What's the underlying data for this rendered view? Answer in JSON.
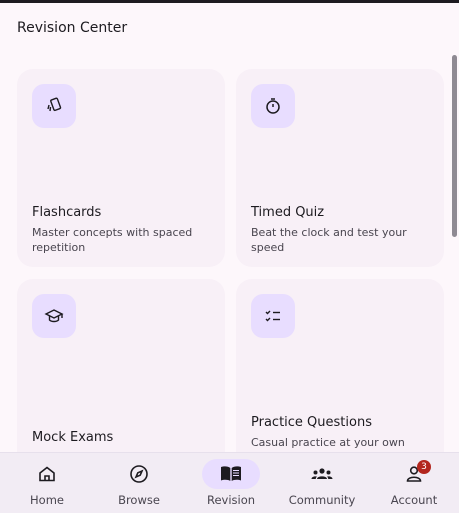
{
  "header": {
    "title": "Revision Center"
  },
  "cards": [
    {
      "title": "Flashcards",
      "desc": "Master concepts with spaced repetition",
      "icon": "flashcards-icon"
    },
    {
      "title": "Timed Quiz",
      "desc": "Beat the clock and test your speed",
      "icon": "timer-icon"
    },
    {
      "title": "Mock Exams",
      "desc": "",
      "icon": "graduation-cap-icon"
    },
    {
      "title": "Practice Questions",
      "desc": "Casual practice at your own",
      "icon": "checklist-icon"
    }
  ],
  "nav": {
    "items": [
      {
        "label": "Home",
        "icon": "home-icon"
      },
      {
        "label": "Browse",
        "icon": "compass-icon"
      },
      {
        "label": "Revision",
        "icon": "book-icon",
        "active": true
      },
      {
        "label": "Community",
        "icon": "people-icon"
      },
      {
        "label": "Account",
        "icon": "account-icon",
        "badge": "3"
      }
    ]
  },
  "colors": {
    "accent": "#e8ddff",
    "background": "#fdf7fb",
    "card": "#f8f0f7",
    "badge": "#b3261e"
  }
}
